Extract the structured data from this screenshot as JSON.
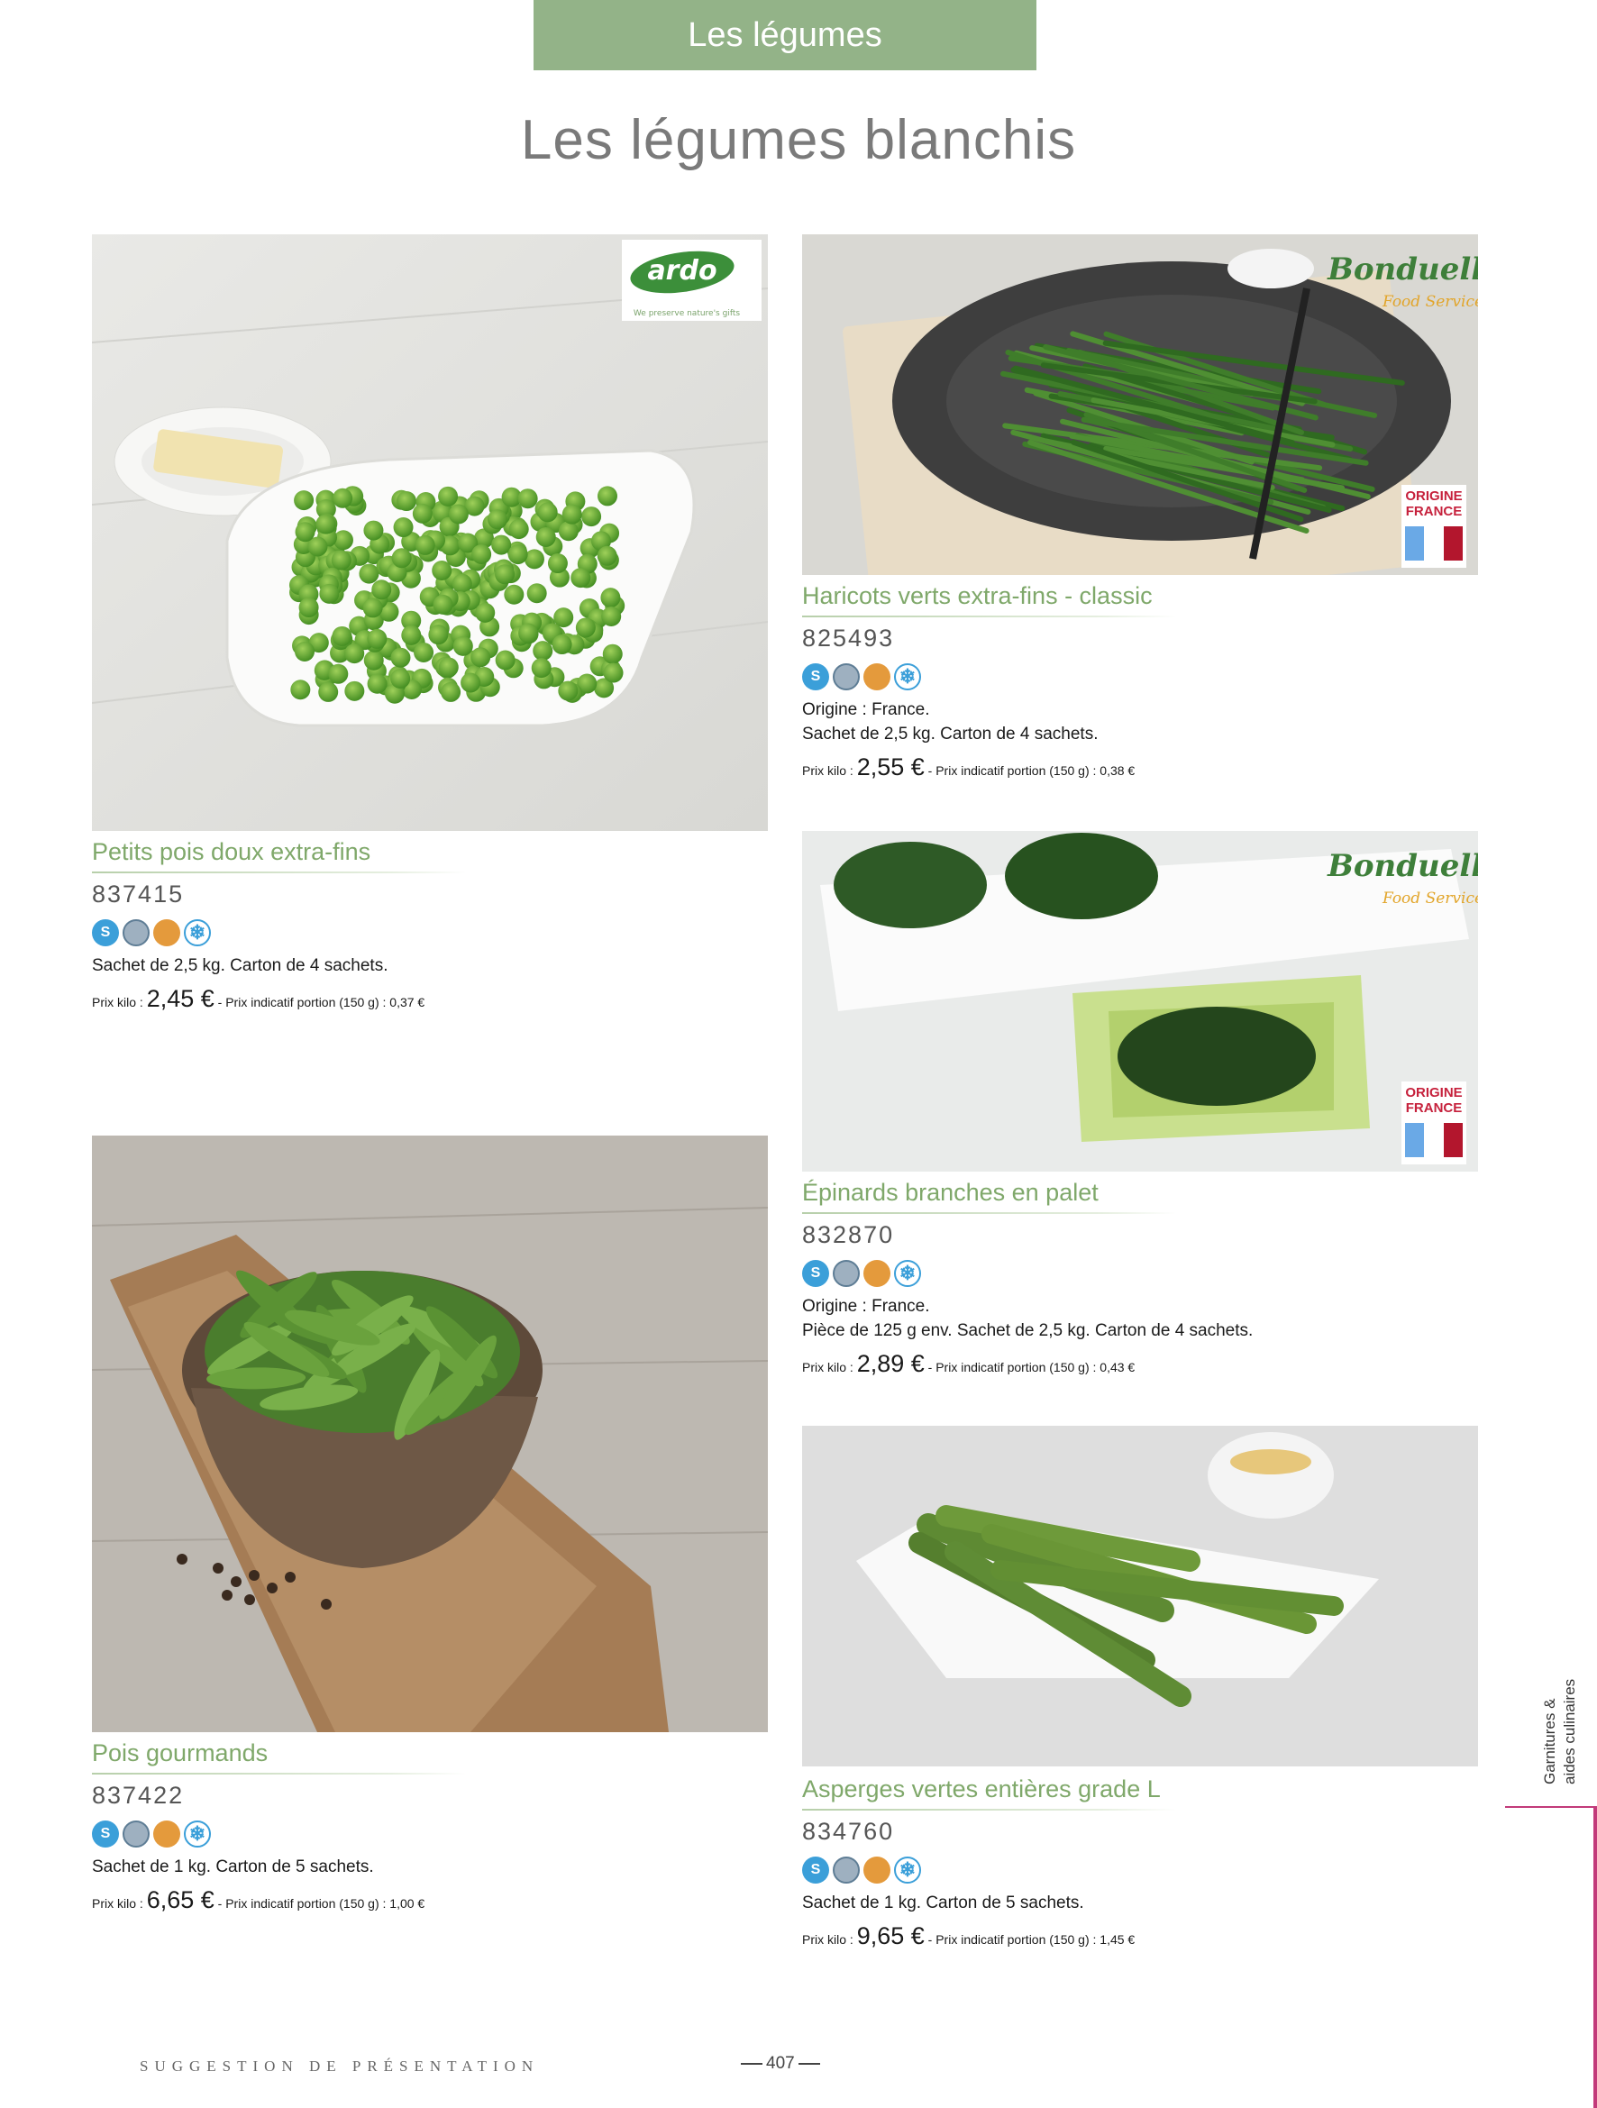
{
  "header": {
    "section": "Les légumes",
    "title": "Les légumes blanchis"
  },
  "logos": {
    "ardo": "ardo",
    "ardo_tagline": "We preserve nature's gifts",
    "bonduelle": "Bonduelle",
    "bonduelle_sub": "Food Service"
  },
  "origin_badge": {
    "line1": "ORIGINE",
    "line2": "FRANCE"
  },
  "icons": {
    "s": "S"
  },
  "products": [
    {
      "name": "Petits pois doux extra-fins",
      "code": "837415",
      "origin": "",
      "desc": "Sachet de 2,5 kg. Carton de 4 sachets.",
      "price_prefix": "Prix kilo :",
      "price": "2,45 €",
      "price_suffix": "- Prix indicatif portion (150 g) : 0,37 €"
    },
    {
      "name": "Haricots verts extra-fins - classic",
      "code": "825493",
      "origin": "Origine : France.",
      "desc": "Sachet de 2,5 kg. Carton de 4 sachets.",
      "price_prefix": "Prix kilo :",
      "price": "2,55 €",
      "price_suffix": "- Prix indicatif portion (150 g) : 0,38 €"
    },
    {
      "name": "Épinards branches en palet",
      "code": "832870",
      "origin": "Origine : France.",
      "desc": "Pièce de 125 g env. Sachet de 2,5 kg. Carton de 4 sachets.",
      "price_prefix": "Prix kilo :",
      "price": "2,89 €",
      "price_suffix": "- Prix indicatif portion (150 g) : 0,43 €"
    },
    {
      "name": "Pois gourmands",
      "code": "837422",
      "origin": "",
      "desc": "Sachet de 1 kg. Carton de 5 sachets.",
      "price_prefix": "Prix kilo :",
      "price": "6,65 €",
      "price_suffix": "- Prix indicatif portion (150 g) : 1,00 €"
    },
    {
      "name": "Asperges vertes entières grade L",
      "code": "834760",
      "origin": "",
      "desc": "Sachet de 1 kg. Carton de 5 sachets.",
      "price_prefix": "Prix kilo :",
      "price": "9,65 €",
      "price_suffix": "- Prix indicatif portion (150 g) : 1,45 €"
    }
  ],
  "footer": {
    "suggestion": "SUGGESTION DE PRÉSENTATION",
    "page": "407"
  },
  "side": {
    "line1": "Garnitures &",
    "line2": "aides culinaires"
  }
}
